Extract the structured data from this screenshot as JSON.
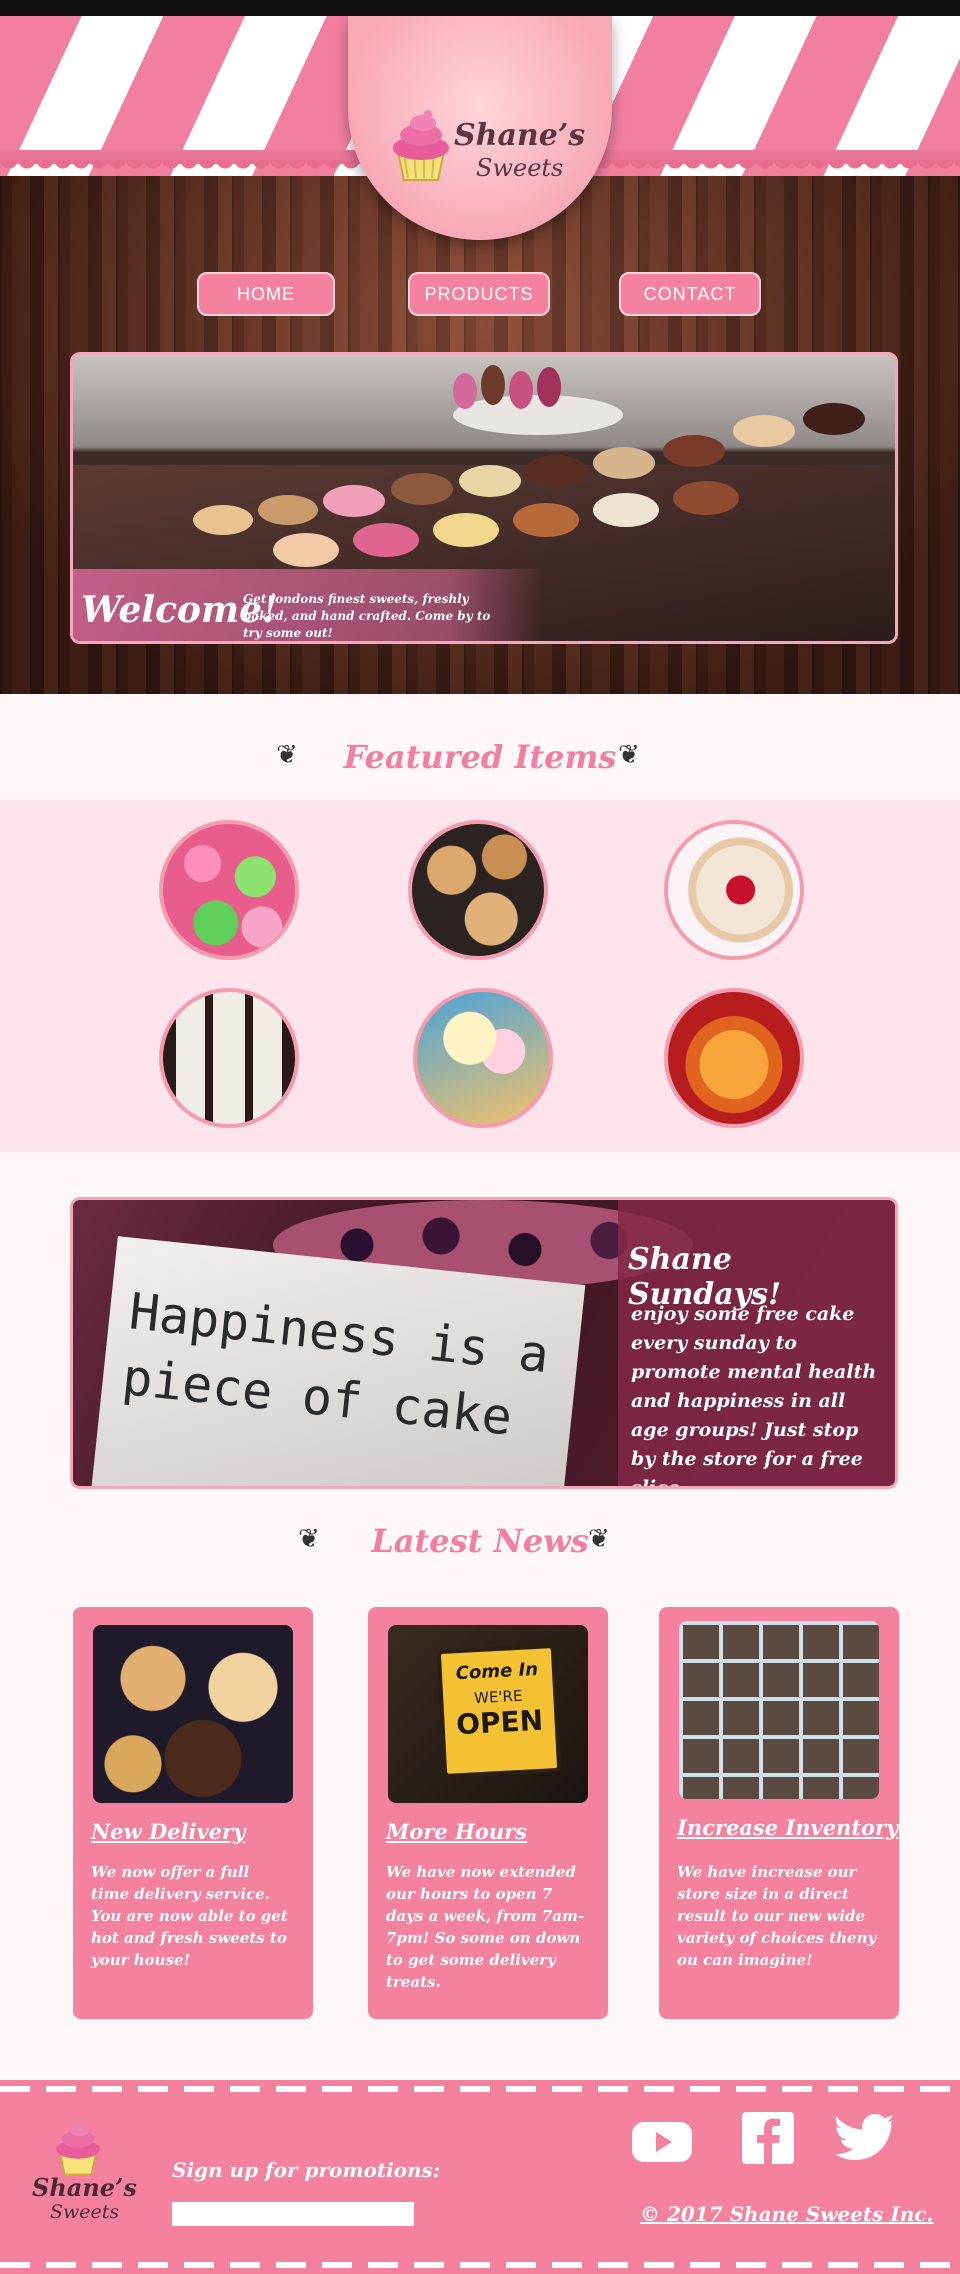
{
  "brand": {
    "name_line1": "Shane’s",
    "name_line2": "Sweets"
  },
  "nav": [
    {
      "label": "HOME"
    },
    {
      "label": "PRODUCTS"
    },
    {
      "label": "CONTACT"
    }
  ],
  "hero": {
    "heading": "Welcome!",
    "subtext": "Get londons finest sweets, freshly baked, and hand crafted. Come by to try some out!"
  },
  "featured": {
    "title": "Featured Items",
    "items": [
      {
        "icon": "macaron-photo"
      },
      {
        "icon": "cookie-photo"
      },
      {
        "icon": "heart-cookie-photo"
      },
      {
        "icon": "parfait-photo"
      },
      {
        "icon": "ice-cream-photo"
      },
      {
        "icon": "gummy-bear-photo"
      }
    ]
  },
  "promo": {
    "photo_text_line1": "Happiness is a",
    "photo_text_line2": "piece of cake",
    "title": "Shane Sundays!",
    "body": "enjoy some free cake every sunday to promote mental health and happiness in all age groups! Just stop by the store for a free slice."
  },
  "news": {
    "title": "Latest News",
    "items": [
      {
        "title": "New Delivery",
        "text": "We now offer a full time delivery service. You are now able to get hot and fresh sweets to your house!"
      },
      {
        "title": "More Hours",
        "text": "We have now extended our hours to open 7 days a week, from 7am-7pm! So some on down to get some delivery treats.",
        "sign_line1": "Come In",
        "sign_line2": "WE'RE",
        "sign_line3": "OPEN"
      },
      {
        "title": "Increase Inventory",
        "text": "We have increase our store size in a direct result to our new wide variety of choices theny ou can imagine!"
      }
    ]
  },
  "footer": {
    "signup_label": "Sign up for promotions:",
    "copyright": "© 2017 Shane Sweets Inc.",
    "social": [
      {
        "icon": "youtube-icon"
      },
      {
        "icon": "facebook-icon"
      },
      {
        "icon": "twitter-icon"
      }
    ]
  },
  "colors": {
    "accent": "#f4829f",
    "title": "#f27fa0",
    "light_band": "#fde3ea"
  }
}
